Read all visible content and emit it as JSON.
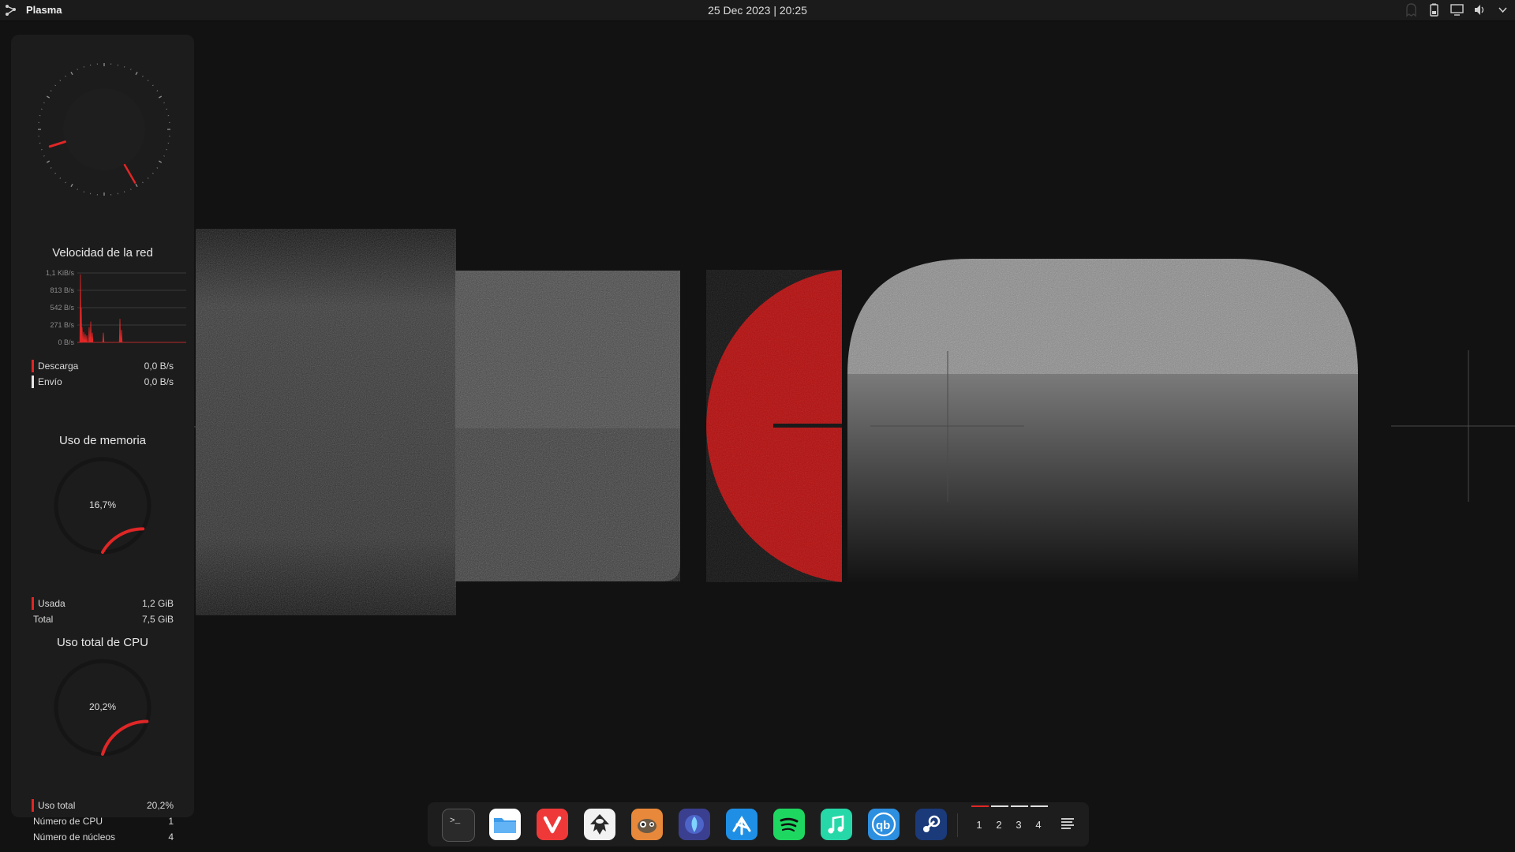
{
  "top_panel": {
    "app_name": "Plasma",
    "datetime": "25 Dec 2023 | 20:25",
    "tray_icons": [
      "ghost-icon",
      "battery-icon",
      "display-icon",
      "volume-icon",
      "chevron-down-icon"
    ]
  },
  "network": {
    "title": "Velocidad de la red",
    "y_ticks": [
      "1,1 KiB/s",
      "813 B/s",
      "542 B/s",
      "271 B/s",
      "0 B/s"
    ],
    "download_label": "Descarga",
    "download_value": "0,0 B/s",
    "upload_label": "Envío",
    "upload_value": "0,0 B/s",
    "download_color": "#e02626",
    "upload_color": "#e6e6e6"
  },
  "memory": {
    "title": "Uso de memoria",
    "percent_text": "16,7%",
    "fraction": 0.167,
    "used_label": "Usada",
    "used_value": "1,2 GiB",
    "total_label": "Total",
    "total_value": "7,5 GiB"
  },
  "cpu": {
    "title": "Uso total de CPU",
    "percent_text": "20,2%",
    "fraction": 0.202,
    "total_label": "Uso total",
    "total_value": "20,2%",
    "count_label": "Número de CPU",
    "count_value": "1",
    "cores_label": "Número de núcleos",
    "cores_value": "4"
  },
  "dock": {
    "apps": [
      "terminal-icon",
      "files-icon",
      "vivaldi-icon",
      "inkscape-icon",
      "gimp-icon",
      "lutris-icon",
      "kdeconnect-icon",
      "spotify-icon",
      "music-icon",
      "qbittorrent-icon",
      "steam-icon"
    ],
    "desktops": [
      "1",
      "2",
      "3",
      "4"
    ],
    "active_desktop_index": 0,
    "accent_color": "#e02626"
  }
}
